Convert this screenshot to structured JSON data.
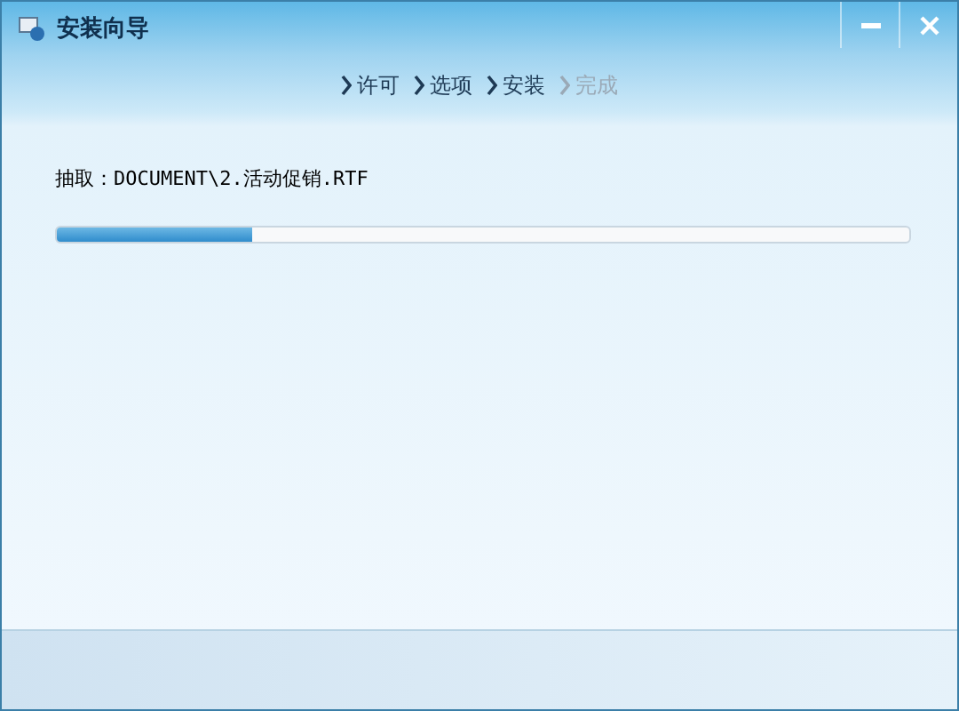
{
  "window": {
    "title": "安装向导"
  },
  "steps": [
    {
      "label": "许可",
      "disabled": false
    },
    {
      "label": "选项",
      "disabled": false
    },
    {
      "label": "安装",
      "disabled": false
    },
    {
      "label": "完成",
      "disabled": true
    }
  ],
  "status": {
    "text": "抽取：DOCUMENT\\2.活动促销.RTF"
  },
  "progress": {
    "level": 0.23
  }
}
